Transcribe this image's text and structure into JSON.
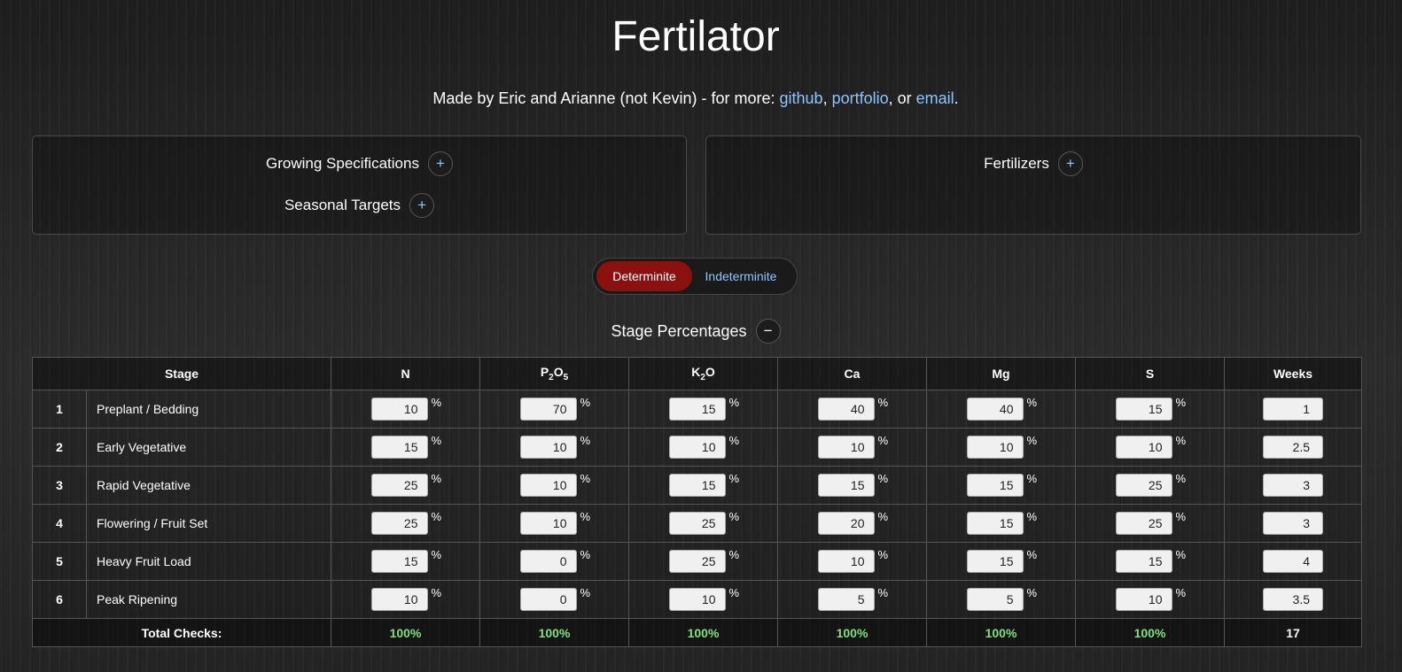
{
  "title": "Fertilator",
  "byline": {
    "prefix": "Made by Eric and Arianne (not Kevin) - for more: ",
    "link_github": "github",
    "sep1": ", ",
    "link_portfolio": "portfolio",
    "sep2": ", or ",
    "link_email": "email",
    "suffix": "."
  },
  "panels": {
    "growing_specifications": "Growing Specifications",
    "seasonal_targets": "Seasonal Targets",
    "fertilizers": "Fertilizers",
    "expand_symbol": "+"
  },
  "toggle": {
    "determinite": "Determinite",
    "indeterminite": "Indeterminite",
    "selected": "Determinite"
  },
  "stage_percentages": {
    "label": "Stage Percentages",
    "collapse_symbol": "−"
  },
  "table": {
    "headers": {
      "stage": "Stage",
      "n": "N",
      "p2o5_a": "P",
      "p2o5_b": "2",
      "p2o5_c": "O",
      "p2o5_d": "5",
      "k2o_a": "K",
      "k2o_b": "2",
      "k2o_c": "O",
      "ca": "Ca",
      "mg": "Mg",
      "s": "S",
      "weeks": "Weeks"
    },
    "percent_sign": "%",
    "rows": [
      {
        "idx": "1",
        "name": "Preplant / Bedding",
        "n": "10",
        "p2o5": "70",
        "k2o": "15",
        "ca": "40",
        "mg": "40",
        "s": "15",
        "weeks": "1"
      },
      {
        "idx": "2",
        "name": "Early Vegetative",
        "n": "15",
        "p2o5": "10",
        "k2o": "10",
        "ca": "10",
        "mg": "10",
        "s": "10",
        "weeks": "2.5"
      },
      {
        "idx": "3",
        "name": "Rapid Vegetative",
        "n": "25",
        "p2o5": "10",
        "k2o": "15",
        "ca": "15",
        "mg": "15",
        "s": "25",
        "weeks": "3"
      },
      {
        "idx": "4",
        "name": "Flowering / Fruit Set",
        "n": "25",
        "p2o5": "10",
        "k2o": "25",
        "ca": "20",
        "mg": "15",
        "s": "25",
        "weeks": "3"
      },
      {
        "idx": "5",
        "name": "Heavy Fruit Load",
        "n": "15",
        "p2o5": "0",
        "k2o": "25",
        "ca": "10",
        "mg": "15",
        "s": "15",
        "weeks": "4"
      },
      {
        "idx": "6",
        "name": "Peak Ripening",
        "n": "10",
        "p2o5": "0",
        "k2o": "10",
        "ca": "5",
        "mg": "5",
        "s": "10",
        "weeks": "3.5"
      }
    ],
    "totals": {
      "label": "Total Checks:",
      "n": "100%",
      "p2o5": "100%",
      "k2o": "100%",
      "ca": "100%",
      "mg": "100%",
      "s": "100%",
      "weeks": "17"
    }
  },
  "colors": {
    "accent_link": "#8ec5ff",
    "toggle_active": "#8b1010",
    "check_ok": "#7fe07f"
  }
}
